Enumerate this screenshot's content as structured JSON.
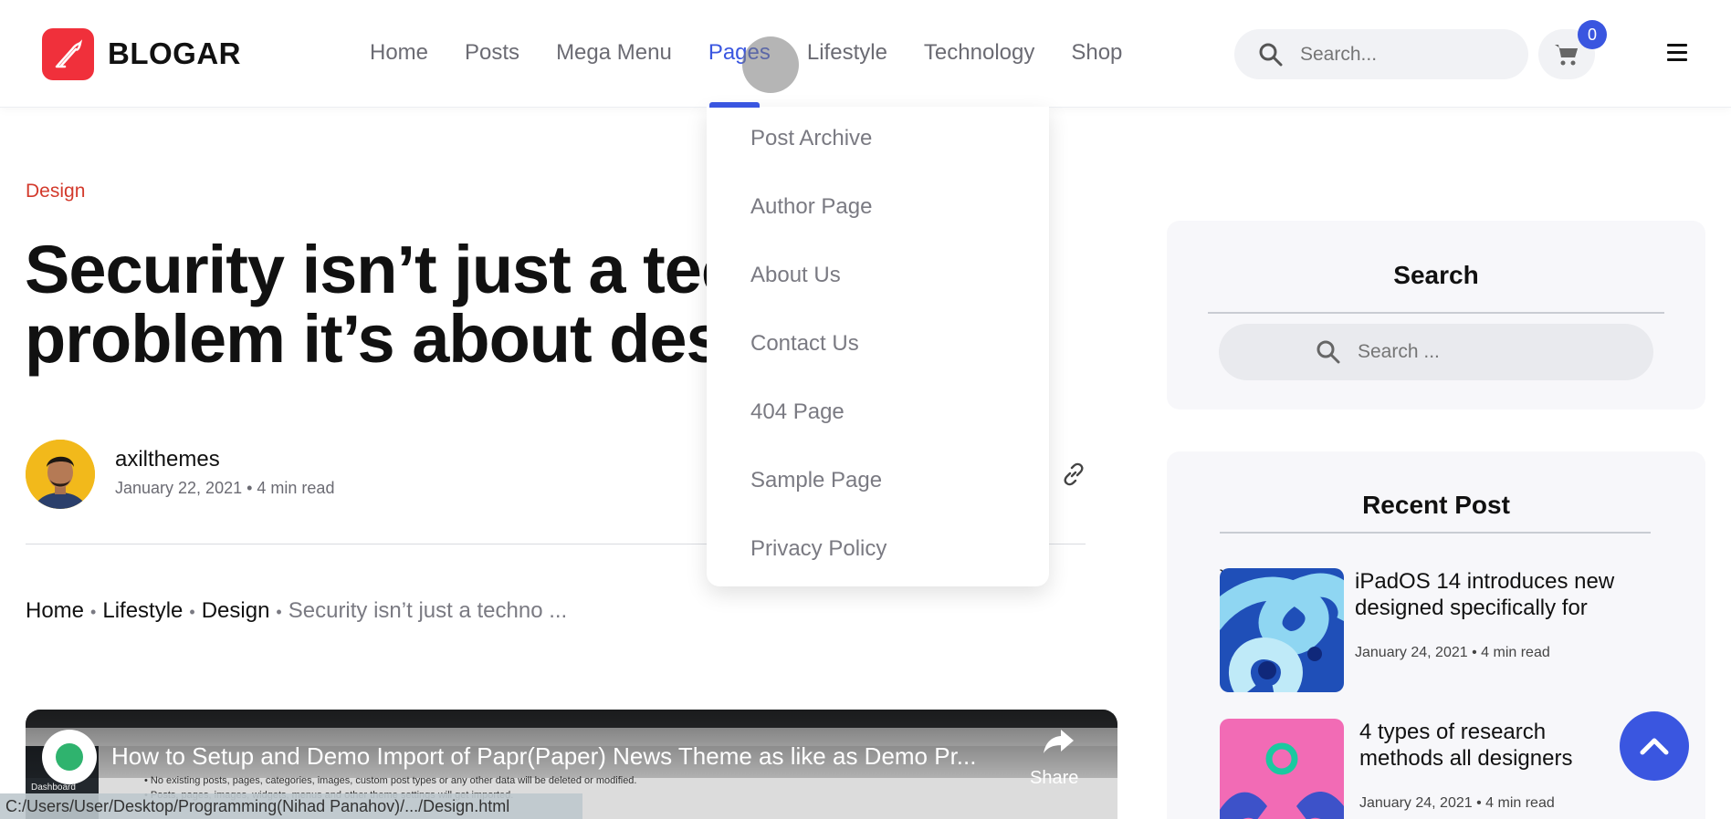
{
  "header": {
    "logo_text": "BLOGAR",
    "nav": [
      "Home",
      "Posts",
      "Mega Menu",
      "Pages",
      "Lifestyle",
      "Technology",
      "Shop"
    ],
    "active_nav": "Pages",
    "search_placeholder": "Search...",
    "cart_count": "0"
  },
  "dropdown": {
    "items": [
      "Post Archive",
      "Author Page",
      "About Us",
      "Contact Us",
      "404 Page",
      "Sample Page",
      "Privacy Policy"
    ]
  },
  "article": {
    "category": "Design",
    "title_line1": "Security isn’t just a tech",
    "title_line2": "problem it’s about desig",
    "author": "axilthemes",
    "meta": "January 22, 2021 • 4 min read",
    "breadcrumb": {
      "home": "Home",
      "lifestyle": "Lifestyle",
      "design": "Design",
      "current": "Security isn’t just a techno ..."
    }
  },
  "video": {
    "title": "How to Setup and Demo Import of Papr(Paper) News Theme as like as Demo Pr...",
    "share_label": "Share",
    "bullet1": "No existing posts, pages, categories, images, custom post types or any other data will be deleted or modified.",
    "bullet2": "Posts, pages, images, widgets, menus and other theme settings will get imported.",
    "wp_label": "Dashboard"
  },
  "statusbar": {
    "text": "C:/Users/User/Desktop/Programming(Nihad Panahov)/.../Design.html"
  },
  "sidebar": {
    "search_title": "Search",
    "search_placeholder": "Search ...",
    "recent_title": "Recent Post",
    "posts": [
      {
        "title": "iPadOS 14 introduces new designed specifically for",
        "meta": "January 24, 2021 • 4 min read"
      },
      {
        "title": "4 types of research methods all designers",
        "meta": "January 24, 2021 • 4 min read"
      }
    ]
  },
  "colors": {
    "accent": "#3a56e0",
    "brand": "#f0303b",
    "category": "#d33a2c"
  }
}
